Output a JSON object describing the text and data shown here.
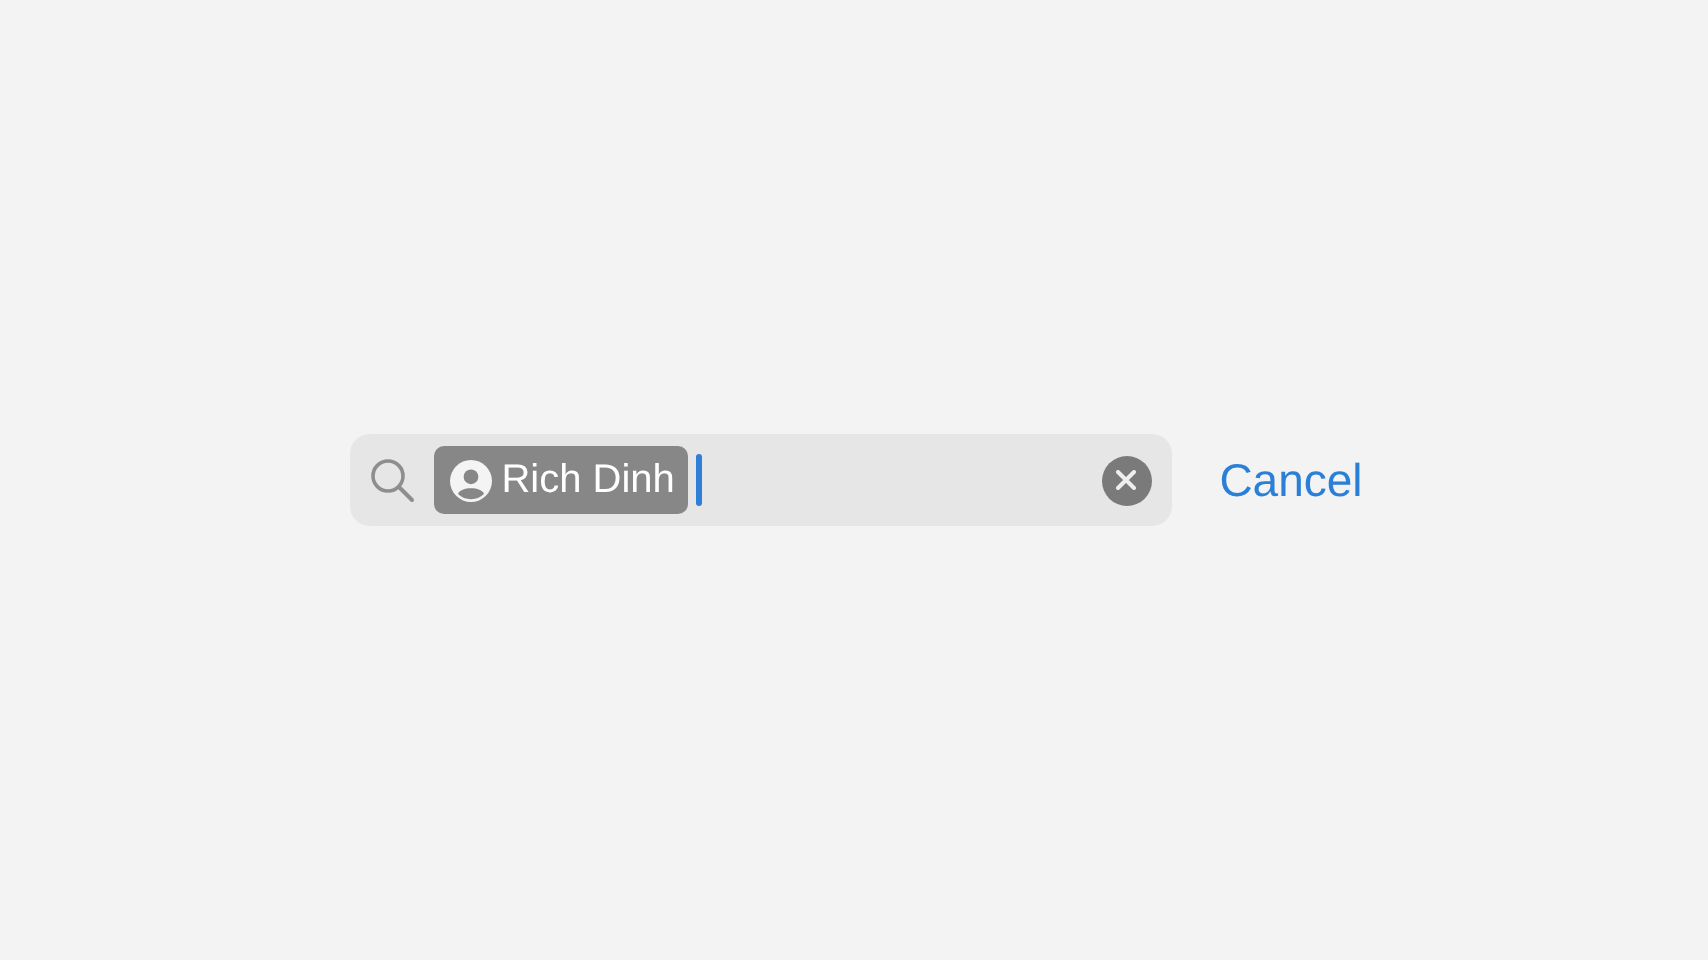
{
  "search": {
    "token": "Rich Dinh",
    "focused": true
  },
  "cancel": "Cancel"
}
